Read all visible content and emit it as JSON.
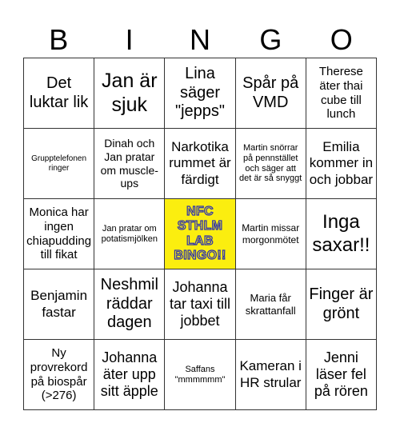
{
  "header": {
    "letters": [
      "B",
      "I",
      "N",
      "G",
      "O"
    ]
  },
  "free_space": {
    "lines": [
      "NFC",
      "STHLM",
      "LAB",
      "BINGO!!"
    ],
    "background": "#fbee0f",
    "outline": "#2a2fb0"
  },
  "rows": [
    [
      "Det luktar lik",
      "Jan är sjuk",
      "Lina säger \"jepps\"",
      "Spår på VMD",
      "Therese äter thai cube till lunch"
    ],
    [
      "Grupptelefonen ringer",
      "Dinah och Jan pratar om muscle-ups",
      "Narkotika rummet är färdigt",
      "Martin snörrar på pennstället och säger att det är så snyggt",
      "Emilia kommer in och jobbar"
    ],
    [
      "Monica har ingen chiapudding till fikat",
      "Jan pratar om potatismjölken",
      "NFC STHLM LAB BINGO!!",
      "Martin missar morgonmötet",
      "Inga saxar!!"
    ],
    [
      "Benjamin fastar",
      "Neshmil räddar dagen",
      "Johanna tar taxi till jobbet",
      "Maria får skrattanfall",
      "Finger är grönt"
    ],
    [
      "Ny provrekord på biospår (>276)",
      "Johanna äter upp sitt äpple",
      "Saffans \"mmmmmm\"",
      "Kameran i HR strular",
      "Jenni läser fel på rören"
    ]
  ]
}
